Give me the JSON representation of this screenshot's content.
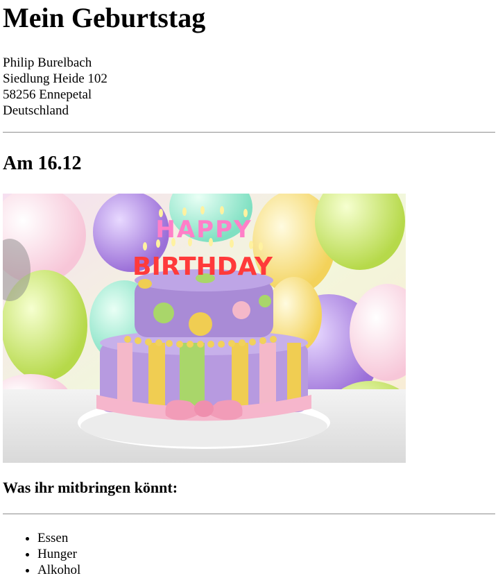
{
  "page": {
    "title": "Mein Geburtstag",
    "address": [
      "Philip Burelbach",
      "Siedlung Heide 102",
      "58256 Ennepetal",
      "Deutschland"
    ],
    "date_heading": "Am 16.12",
    "image": {
      "subject": "birthday cake with Happy Birthday candles in front of colorful balloons",
      "candle_text_top": "HAPPY",
      "candle_text_bottom": "BIRTHDAY"
    },
    "bring_heading": "Was ihr mitbringen könnt:",
    "bring_items": [
      "Essen",
      "Hunger",
      "Alkohol"
    ]
  }
}
